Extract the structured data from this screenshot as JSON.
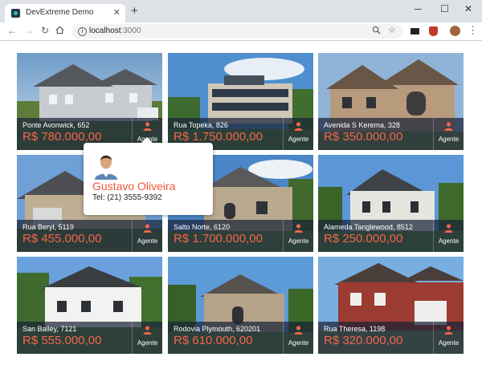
{
  "browser": {
    "tab_title": "DevExtreme Demo",
    "url_host": "localhost",
    "url_port": ":3000"
  },
  "icons": {
    "tab_close": "close-icon",
    "new_tab": "plus-icon",
    "back": "arrow-left-icon",
    "forward": "arrow-right-icon",
    "reload": "reload-icon",
    "home": "home-icon",
    "zoom": "zoom-icon",
    "bookmark": "star-icon",
    "agent": "person-icon"
  },
  "colors": {
    "price": "#f4664a",
    "selection": "#e8573f",
    "popup_name": "#f05a3c"
  },
  "agent_label": "Agente",
  "houses": [
    {
      "address": "Ponte Avonwick, 652",
      "price": "R$ 780.000,00",
      "selected": true
    },
    {
      "address": "Rua Topeka, 826",
      "price": "R$ 1.750.000,00",
      "selected": false
    },
    {
      "address": "Avenida S Kerema, 328",
      "price": "R$ 350.000,00",
      "selected": false
    },
    {
      "address": "Rua Beryl, 5119",
      "price": "R$ 455.000,00",
      "selected": false
    },
    {
      "address": "Salto Norte, 6120",
      "price": "R$ 1.700.000,00",
      "selected": false
    },
    {
      "address": "Alameda Tanglewood, 8512",
      "price": "R$ 250.000,00",
      "selected": false
    },
    {
      "address": "San Bailey, 7121",
      "price": "R$ 555.000,00",
      "selected": false
    },
    {
      "address": "Rodovia Plymouth, 620201",
      "price": "R$ 610.000,00",
      "selected": false
    },
    {
      "address": "Rua Theresa, 1198",
      "price": "R$ 320.000,00",
      "selected": false
    }
  ],
  "popup": {
    "name": "Gustavo Oliveira",
    "phone": "Tel: (21) 3555-9392"
  }
}
